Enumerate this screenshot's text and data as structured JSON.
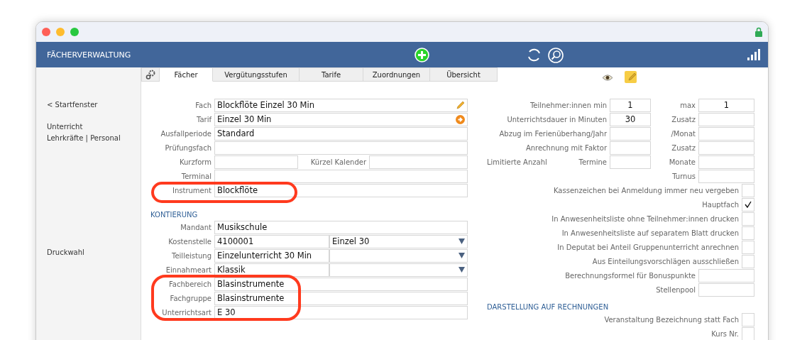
{
  "window": {
    "title": "FÄCHERVERWALTUNG"
  },
  "sidebar": {
    "groups": [
      [
        "< Startfenster"
      ],
      [
        "Unterricht",
        "Lehrkräfte | Personal"
      ],
      [
        "Druckwahl"
      ]
    ]
  },
  "tabs": [
    {
      "label": "Fächer",
      "selected": true
    },
    {
      "label": "Vergütungsstufen",
      "selected": false
    },
    {
      "label": "Tarife",
      "selected": false
    },
    {
      "label": "Zuordnungen",
      "selected": false
    },
    {
      "label": "Übersicht",
      "selected": false
    }
  ],
  "left_form": [
    {
      "kind": "edit",
      "label": "Fach",
      "value": "Blockflöte Einzel 30 Min"
    },
    {
      "kind": "link",
      "label": "Tarif",
      "value": "Einzel 30 Min"
    },
    {
      "kind": "text",
      "label": "Ausfallperiode",
      "value": "Standard"
    },
    {
      "kind": "text",
      "label": "Prüfungsfach"
    },
    {
      "kind": "split",
      "label": "Kurzform",
      "label2": "Kürzel Kalender"
    },
    {
      "kind": "text",
      "label": "Terminal"
    },
    {
      "kind": "text",
      "label": "Instrument",
      "value": "Blockflöte"
    },
    {
      "kind": "section",
      "label": "KONTIERUNG"
    },
    {
      "kind": "text",
      "label": "Mandant",
      "value": "Musikschule"
    },
    {
      "kind": "select",
      "label": "Kostenstelle",
      "value": "4100001",
      "value2": "Einzel 30"
    },
    {
      "kind": "select",
      "label": "Teilleistung",
      "value": "Einzelunterricht 30 Min"
    },
    {
      "kind": "select",
      "label": "Einnahmeart",
      "value": "Klassik"
    },
    {
      "kind": "text",
      "label": "Fachbereich",
      "value": "Blasinstrumente"
    },
    {
      "kind": "text",
      "label": "Fachgruppe",
      "value": "Blasinstrumente"
    },
    {
      "kind": "text",
      "label": "Unterrichtsart",
      "value": "E 30"
    }
  ],
  "right_form": [
    {
      "kind": "pair",
      "label": "Teilnehmer:innen min",
      "value": "1",
      "label2": "max",
      "value2": "1"
    },
    {
      "kind": "pair",
      "label": "Unterrichtsdauer in Minuten",
      "value": "30",
      "label2": "Zusatz"
    },
    {
      "kind": "pair",
      "label": "Abzug im Ferienüberhang/Jahr",
      "label2": "/Monat"
    },
    {
      "kind": "pair",
      "label": "Anrechnung mit Faktor",
      "label2": "Zusatz"
    },
    {
      "kind": "pair",
      "lead": "Limitierte Anzahl",
      "label": "Termine",
      "label2": "Monate"
    },
    {
      "kind": "end",
      "label2": "Turnus"
    },
    {
      "kind": "check",
      "label": "Kassenzeichen bei Anmeldung immer neu vergeben",
      "checked": false
    },
    {
      "kind": "check",
      "label": "Hauptfach",
      "checked": true
    },
    {
      "kind": "check",
      "label": "In Anwesenheitsliste ohne Teilnehmer:innen drucken",
      "checked": false
    },
    {
      "kind": "check",
      "label": "In Anwesenheitsliste auf separatem Blatt drucken",
      "checked": false
    },
    {
      "kind": "check",
      "label": "In Deputat bei Anteil Gruppenunterricht anrechnen",
      "checked": false
    },
    {
      "kind": "check",
      "label": "Aus Einteilungsvorschlägen ausschließen",
      "checked": false
    },
    {
      "kind": "end",
      "label2": "Berechnungsformel für Bonuspunkte"
    },
    {
      "kind": "end",
      "label2": "Stellenpool"
    },
    {
      "kind": "section",
      "label": "DARSTELLUNG AUF RECHNUNGEN"
    },
    {
      "kind": "check",
      "label": "Veranstaltung Bezeichnung statt Fach",
      "checked": false
    },
    {
      "kind": "check",
      "label": "Kurs Nr.",
      "checked": false
    }
  ]
}
